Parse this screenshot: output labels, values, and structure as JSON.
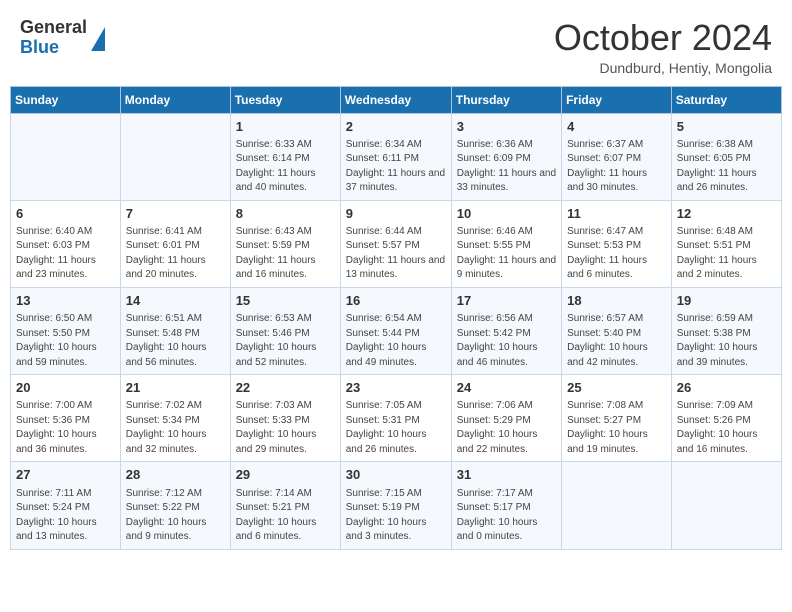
{
  "header": {
    "logo_general": "General",
    "logo_blue": "Blue",
    "month_title": "October 2024",
    "location": "Dundburd, Hentiy, Mongolia"
  },
  "days_of_week": [
    "Sunday",
    "Monday",
    "Tuesday",
    "Wednesday",
    "Thursday",
    "Friday",
    "Saturday"
  ],
  "weeks": [
    [
      {
        "day": "",
        "content": ""
      },
      {
        "day": "",
        "content": ""
      },
      {
        "day": "1",
        "content": "Sunrise: 6:33 AM\nSunset: 6:14 PM\nDaylight: 11 hours and 40 minutes."
      },
      {
        "day": "2",
        "content": "Sunrise: 6:34 AM\nSunset: 6:11 PM\nDaylight: 11 hours and 37 minutes."
      },
      {
        "day": "3",
        "content": "Sunrise: 6:36 AM\nSunset: 6:09 PM\nDaylight: 11 hours and 33 minutes."
      },
      {
        "day": "4",
        "content": "Sunrise: 6:37 AM\nSunset: 6:07 PM\nDaylight: 11 hours and 30 minutes."
      },
      {
        "day": "5",
        "content": "Sunrise: 6:38 AM\nSunset: 6:05 PM\nDaylight: 11 hours and 26 minutes."
      }
    ],
    [
      {
        "day": "6",
        "content": "Sunrise: 6:40 AM\nSunset: 6:03 PM\nDaylight: 11 hours and 23 minutes."
      },
      {
        "day": "7",
        "content": "Sunrise: 6:41 AM\nSunset: 6:01 PM\nDaylight: 11 hours and 20 minutes."
      },
      {
        "day": "8",
        "content": "Sunrise: 6:43 AM\nSunset: 5:59 PM\nDaylight: 11 hours and 16 minutes."
      },
      {
        "day": "9",
        "content": "Sunrise: 6:44 AM\nSunset: 5:57 PM\nDaylight: 11 hours and 13 minutes."
      },
      {
        "day": "10",
        "content": "Sunrise: 6:46 AM\nSunset: 5:55 PM\nDaylight: 11 hours and 9 minutes."
      },
      {
        "day": "11",
        "content": "Sunrise: 6:47 AM\nSunset: 5:53 PM\nDaylight: 11 hours and 6 minutes."
      },
      {
        "day": "12",
        "content": "Sunrise: 6:48 AM\nSunset: 5:51 PM\nDaylight: 11 hours and 2 minutes."
      }
    ],
    [
      {
        "day": "13",
        "content": "Sunrise: 6:50 AM\nSunset: 5:50 PM\nDaylight: 10 hours and 59 minutes."
      },
      {
        "day": "14",
        "content": "Sunrise: 6:51 AM\nSunset: 5:48 PM\nDaylight: 10 hours and 56 minutes."
      },
      {
        "day": "15",
        "content": "Sunrise: 6:53 AM\nSunset: 5:46 PM\nDaylight: 10 hours and 52 minutes."
      },
      {
        "day": "16",
        "content": "Sunrise: 6:54 AM\nSunset: 5:44 PM\nDaylight: 10 hours and 49 minutes."
      },
      {
        "day": "17",
        "content": "Sunrise: 6:56 AM\nSunset: 5:42 PM\nDaylight: 10 hours and 46 minutes."
      },
      {
        "day": "18",
        "content": "Sunrise: 6:57 AM\nSunset: 5:40 PM\nDaylight: 10 hours and 42 minutes."
      },
      {
        "day": "19",
        "content": "Sunrise: 6:59 AM\nSunset: 5:38 PM\nDaylight: 10 hours and 39 minutes."
      }
    ],
    [
      {
        "day": "20",
        "content": "Sunrise: 7:00 AM\nSunset: 5:36 PM\nDaylight: 10 hours and 36 minutes."
      },
      {
        "day": "21",
        "content": "Sunrise: 7:02 AM\nSunset: 5:34 PM\nDaylight: 10 hours and 32 minutes."
      },
      {
        "day": "22",
        "content": "Sunrise: 7:03 AM\nSunset: 5:33 PM\nDaylight: 10 hours and 29 minutes."
      },
      {
        "day": "23",
        "content": "Sunrise: 7:05 AM\nSunset: 5:31 PM\nDaylight: 10 hours and 26 minutes."
      },
      {
        "day": "24",
        "content": "Sunrise: 7:06 AM\nSunset: 5:29 PM\nDaylight: 10 hours and 22 minutes."
      },
      {
        "day": "25",
        "content": "Sunrise: 7:08 AM\nSunset: 5:27 PM\nDaylight: 10 hours and 19 minutes."
      },
      {
        "day": "26",
        "content": "Sunrise: 7:09 AM\nSunset: 5:26 PM\nDaylight: 10 hours and 16 minutes."
      }
    ],
    [
      {
        "day": "27",
        "content": "Sunrise: 7:11 AM\nSunset: 5:24 PM\nDaylight: 10 hours and 13 minutes."
      },
      {
        "day": "28",
        "content": "Sunrise: 7:12 AM\nSunset: 5:22 PM\nDaylight: 10 hours and 9 minutes."
      },
      {
        "day": "29",
        "content": "Sunrise: 7:14 AM\nSunset: 5:21 PM\nDaylight: 10 hours and 6 minutes."
      },
      {
        "day": "30",
        "content": "Sunrise: 7:15 AM\nSunset: 5:19 PM\nDaylight: 10 hours and 3 minutes."
      },
      {
        "day": "31",
        "content": "Sunrise: 7:17 AM\nSunset: 5:17 PM\nDaylight: 10 hours and 0 minutes."
      },
      {
        "day": "",
        "content": ""
      },
      {
        "day": "",
        "content": ""
      }
    ]
  ]
}
